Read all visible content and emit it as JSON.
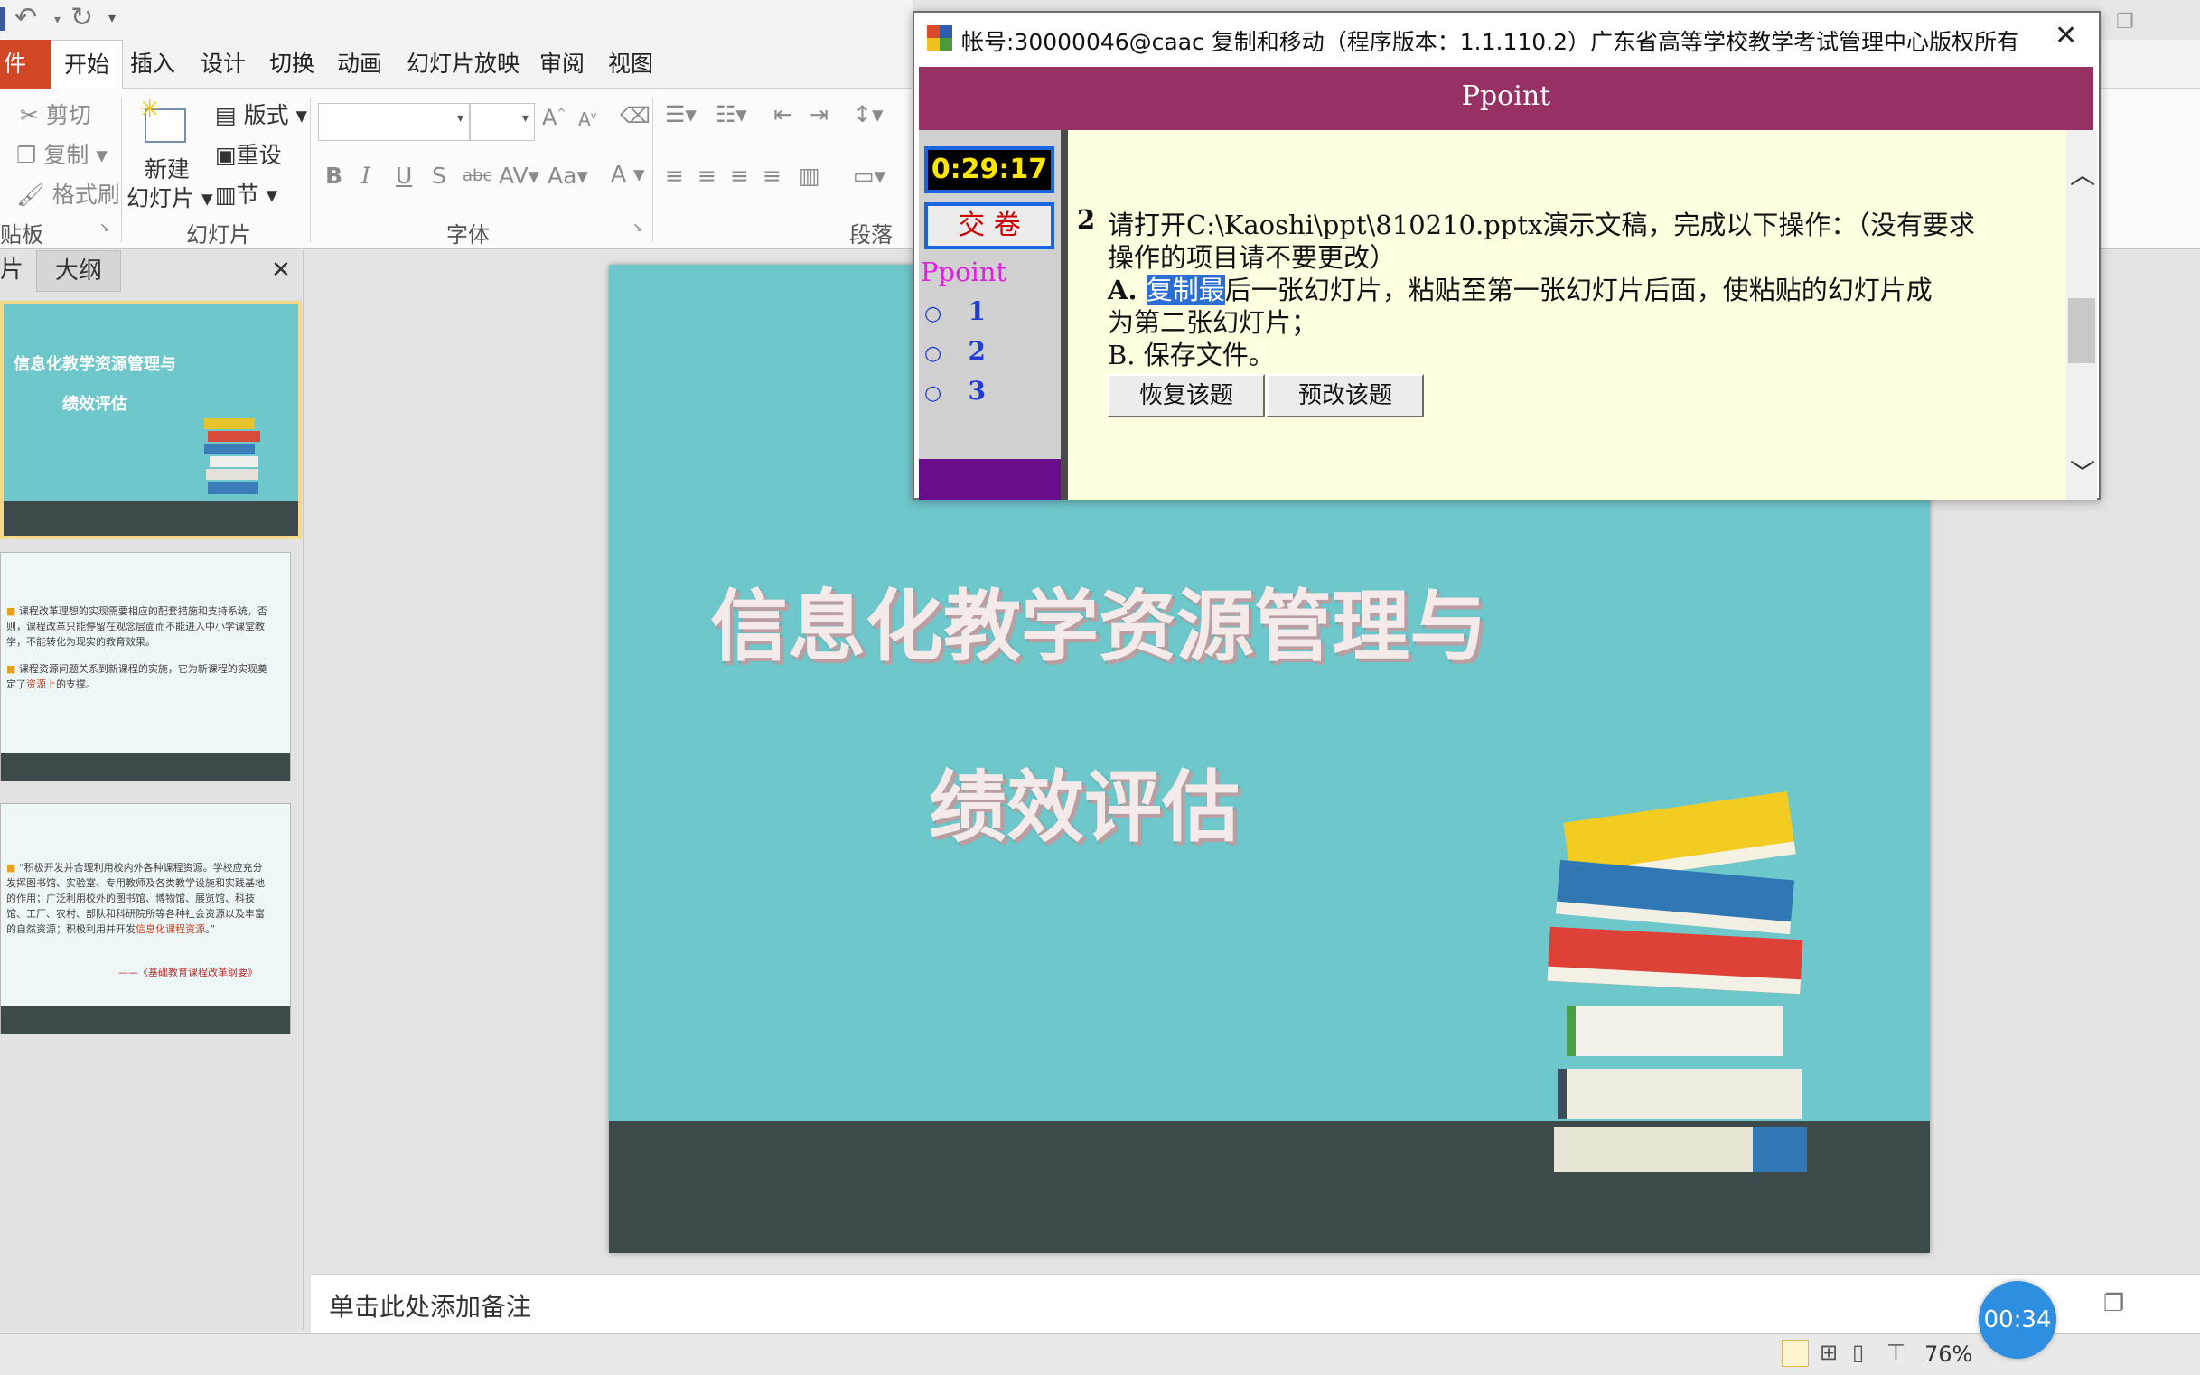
{
  "quick_access": {
    "undo_icon": "undo-icon",
    "redo_icon": "redo-icon",
    "customize_icon": "customize-arrow-icon"
  },
  "tabs": [
    "件",
    "开始",
    "插入",
    "设计",
    "切换",
    "动画",
    "幻灯片放映",
    "审阅",
    "视图"
  ],
  "ribbon": {
    "clipboard": {
      "cut": "剪切",
      "copy": "复制",
      "format_painter": "格式刷",
      "group_label": "贴板"
    },
    "slides": {
      "new_slide_line1": "新建",
      "new_slide_line2": "幻灯片",
      "layout": "版式",
      "reset": "重设",
      "section": "节",
      "group_label": "幻灯片"
    },
    "font": {
      "group_label": "字体",
      "bold": "B",
      "italic": "I",
      "underline": "U",
      "shadow": "S",
      "strike": "abc",
      "spacing": "AV",
      "case": "Aa",
      "grow": "A",
      "shrink": "A"
    },
    "paragraph": {
      "group_label": "段落"
    }
  },
  "left_panel": {
    "tab_slides": "片",
    "tab_outline": "大纲",
    "close": "✕",
    "thumb1": {
      "title_line1": "信息化教学资源管理与",
      "title_line2": "绩效评估"
    },
    "thumb2": {
      "bullet1": "课程改革理想的实现需要相应的配套措施和支持系统，否则，课程改革只能停留在观念层面而不能进入中小学课堂教学，不能转化为现实的教育效果。",
      "bullet2a": "课程资源问题关系到新课程的实施，它为新课程的实现奠定了",
      "bullet2b": "资源上",
      "bullet2c": "的支撑。"
    },
    "thumb3": {
      "quote_a": "“积极开发并合理利用校内外各种课程资源。学校应充分发挥图书馆、实验室、专用教师及各类教学设施和实践基地的作用；广泛利用校外的图书馆、博物馆、展览馆、科技馆、工厂、农村、部队和科研院所等各种社会资源以及丰富的自然资源；积极利用并开发",
      "quote_b": "信息化课程资源",
      "quote_c": "。”",
      "source": "——《基础教育课程改革纲要》"
    }
  },
  "slide": {
    "title_line1": "信息化教学资源管理与",
    "title_line2": "绩效评估"
  },
  "notes_placeholder": "单击此处添加备注",
  "status": {
    "zoom": "76%"
  },
  "timer_overlay": "00:34",
  "exam": {
    "window_title": "帐号:30000046@caac  复制和移动（程序版本：1.1.110.2）广东省高等学校教学考试管理中心版权所有",
    "close": "✕",
    "header": "Ppoint",
    "timer": "0:29:17",
    "submit": "交 卷",
    "nav_title": "Ppoint",
    "nav_items": [
      "1",
      "2",
      "3"
    ],
    "question_number": "2",
    "line1": "请打开C:\\Kaoshi\\ppt\\810210.pptx演示文稿，完成以下操作：（没有要求",
    "line2": "操作的项目请不要更改）",
    "line3_prefix": "A.  ",
    "line3_selected": "复制最",
    "line3_rest": "后一张幻灯片，粘贴至第一张幻灯片后面，使粘贴的幻灯片成",
    "line4": "为第二张幻灯片；",
    "line5": "B.  保存文件。",
    "btn_restore": "恢复该题",
    "btn_preview": "预改该题"
  },
  "colors": {
    "exam_header": "#973163",
    "exam_content_bg": "#fffee0",
    "slide_bg": "#6ec7cb",
    "slide_footer": "#3c4a4b",
    "file_tab": "#d24726",
    "nav_accent": "#6a0d8c"
  }
}
